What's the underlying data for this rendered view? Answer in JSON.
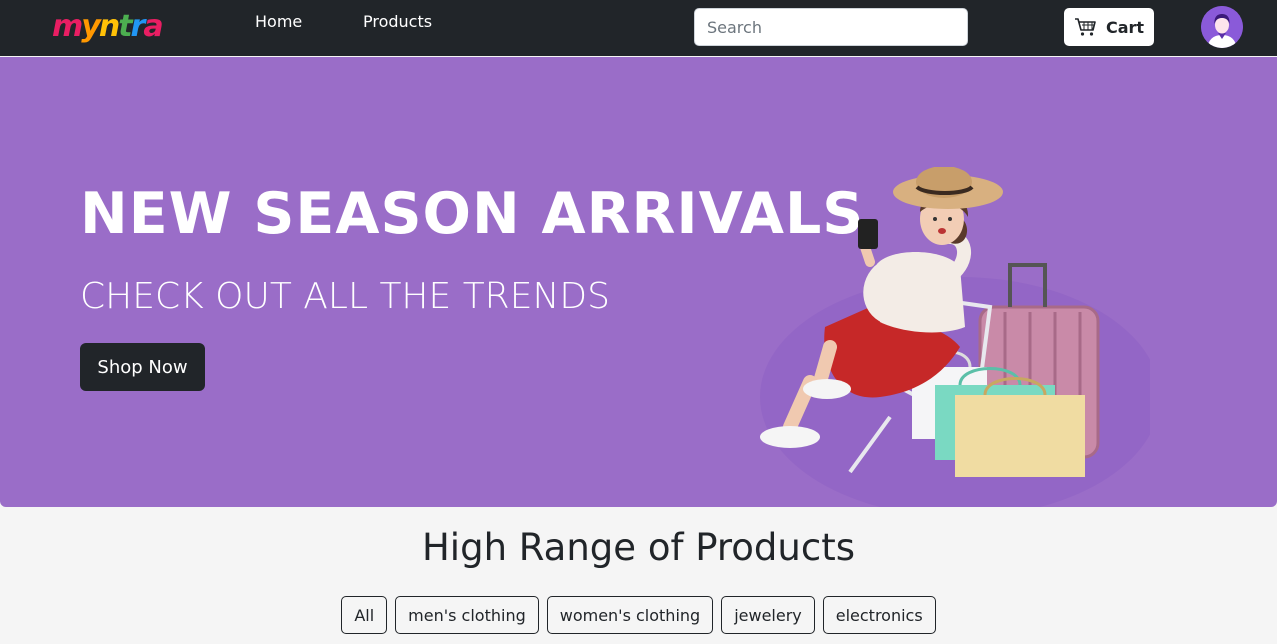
{
  "brand": {
    "logo_text": "myntra",
    "logo_colors": [
      "#e91e63",
      "#ff9800",
      "#ffc107",
      "#4caf50",
      "#2196f3",
      "#9c27b0"
    ]
  },
  "nav": {
    "links": [
      {
        "label": "Home"
      },
      {
        "label": "Products"
      }
    ]
  },
  "search": {
    "placeholder": "Search",
    "value": ""
  },
  "cart": {
    "label": "Cart",
    "icon": "cart-icon"
  },
  "user": {
    "icon": "user-avatar"
  },
  "hero": {
    "title": "NEW SEASON ARRIVALS",
    "subtitle": "CHECK OUT ALL THE TRENDS",
    "cta_label": "Shop Now",
    "background_color": "#9a6dc8"
  },
  "section": {
    "title": "High Range of Products"
  },
  "filters": [
    {
      "label": "All"
    },
    {
      "label": "men's clothing"
    },
    {
      "label": "women's clothing"
    },
    {
      "label": "jewelery"
    },
    {
      "label": "electronics"
    }
  ],
  "colors": {
    "navbar": "#212529",
    "accent": "#9a6dc8",
    "dark": "#212529"
  }
}
